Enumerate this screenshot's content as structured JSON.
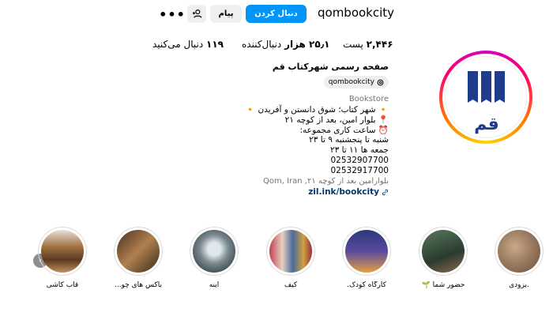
{
  "profile": {
    "username": "qombookcity",
    "follow_label": "دنبال کردن",
    "message_label": "پیام",
    "suggest_icon": "person-add-icon",
    "more_icon": "more-options-icon",
    "more_glyph": "•••",
    "stats": {
      "posts_value": "۲,۴۴۶",
      "posts_label": "پست",
      "followers_value": "۲۵٫۱ هزار",
      "followers_label": "دنبال‌کننده",
      "following_value": "۱۱۹",
      "following_label": "دنبال می‌کنید"
    },
    "full_name": "صفحه رسمی شهرکتاب قم",
    "threads_handle": "qombookcity",
    "category": "Bookstore",
    "bio_lines": [
      "🔸 شهر کتاب؛ شوق دانستن و آفریدن 🔸",
      "📍 بلوار امین، بعد از کوچه ۲۱",
      "⏰ ساعت کاری مجموعه:",
      "شنبه تا پنجشنبه ۹ تا ۲۳",
      "جمعه ها ۱۱ تا ۲۳"
    ],
    "phones": [
      "02532907700",
      "02532917700"
    ],
    "address": "بلوارامین بعد از کوچه ۲۱, Qom, Iran",
    "link": "zil.ink/bookcity",
    "avatar_text": "قم",
    "accent_color": "#0095f6",
    "logo_color": "#1f3c8c"
  },
  "highlights": [
    {
      "label": ".بزودی",
      "color": "#8a6a50"
    },
    {
      "label": "حضور شما 🌱",
      "color": "#3f5a45"
    },
    {
      "label": "کارگاه کودک.",
      "color": "#3a4a8a"
    },
    {
      "label": "کیف",
      "color": "#9a3a4a"
    },
    {
      "label": "آینه",
      "color": "#6a7a80"
    },
    {
      "label": "باکس های چو...",
      "color": "#6a4a30"
    },
    {
      "label": "قاب کاشی",
      "color": "#8a5a38"
    }
  ],
  "nav": {
    "prev_glyph": "‹"
  }
}
